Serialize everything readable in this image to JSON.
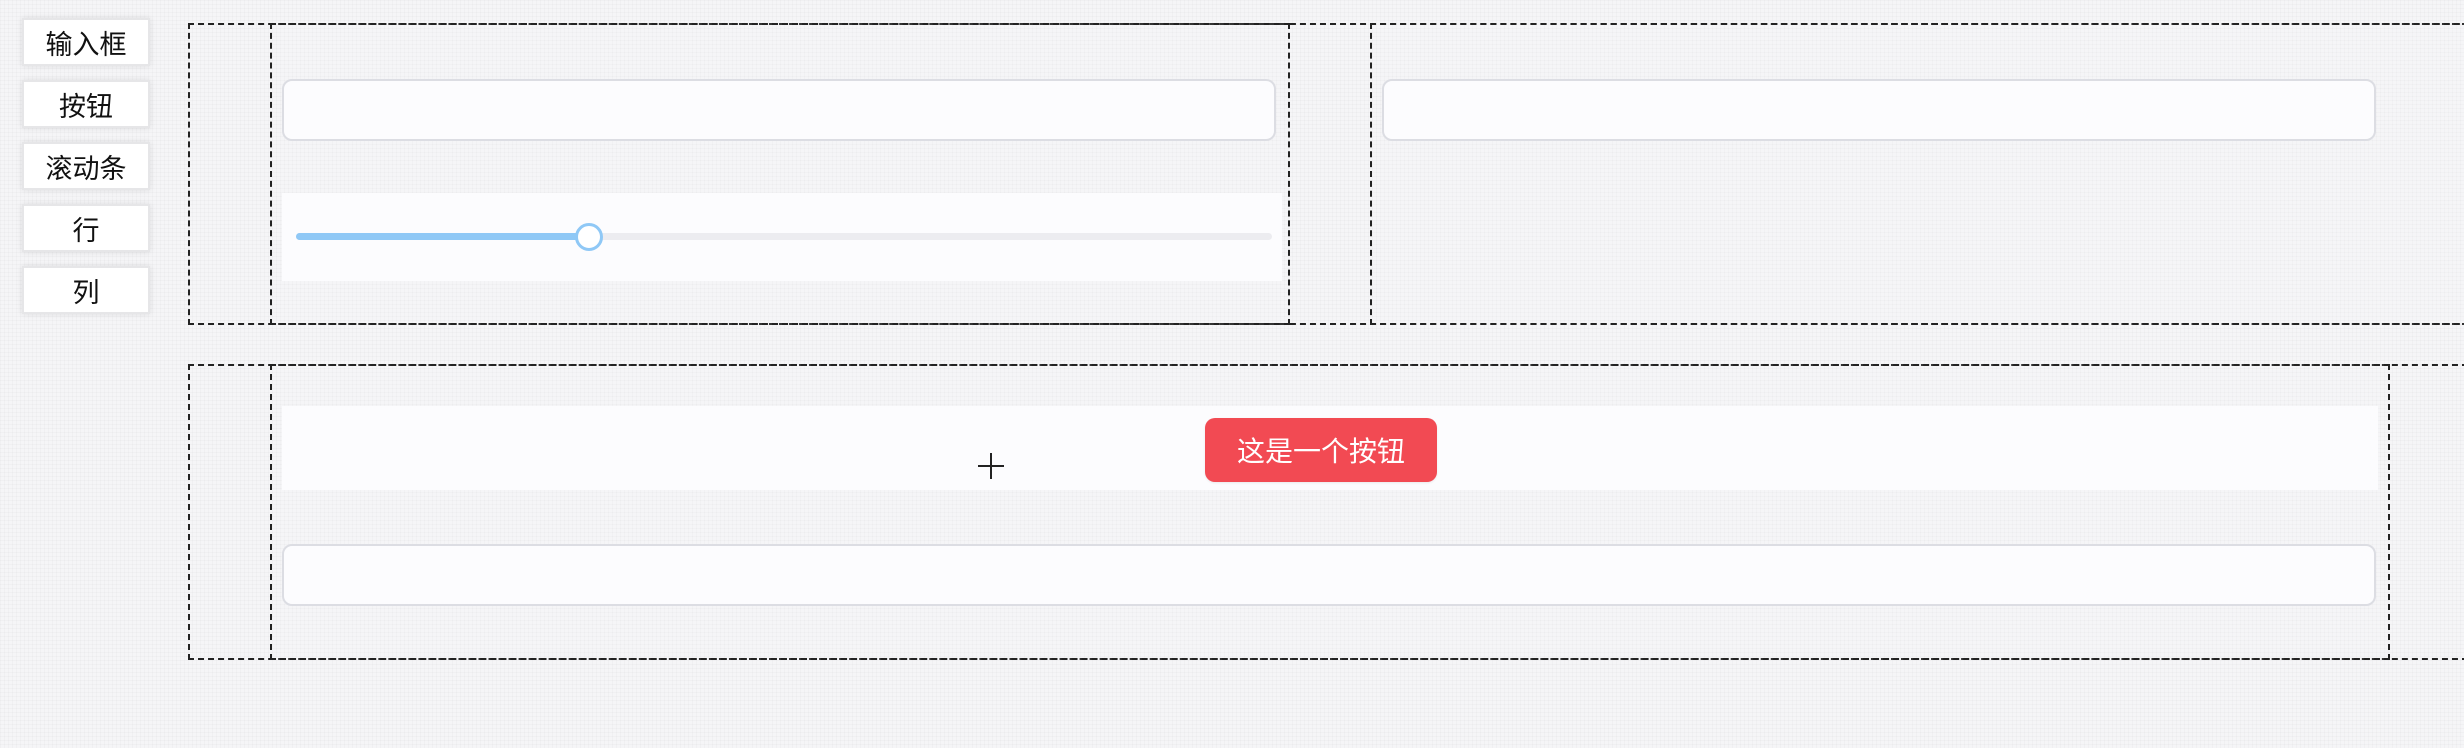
{
  "palette": {
    "items": [
      {
        "label": "输入框",
        "key": "input"
      },
      {
        "label": "按钮",
        "key": "button"
      },
      {
        "label": "滚动条",
        "key": "slider"
      },
      {
        "label": "行",
        "key": "row"
      },
      {
        "label": "列",
        "key": "column"
      }
    ]
  },
  "canvas": {
    "row_1": {
      "col_a": {
        "input": {
          "value": "",
          "placeholder": ""
        },
        "slider": {
          "value": 30,
          "min": 0,
          "max": 100
        }
      },
      "col_b": {
        "input": {
          "value": "",
          "placeholder": ""
        }
      }
    },
    "row_2": {
      "col_c": {
        "button": {
          "label": "这是一个按钮"
        },
        "input": {
          "value": "",
          "placeholder": ""
        }
      }
    }
  },
  "colors": {
    "primary_button": "#f24a53",
    "slider_accent": "#8fc8f6",
    "border_dashed": "#222222"
  },
  "cursor": {
    "icon": "crosshair-icon"
  }
}
